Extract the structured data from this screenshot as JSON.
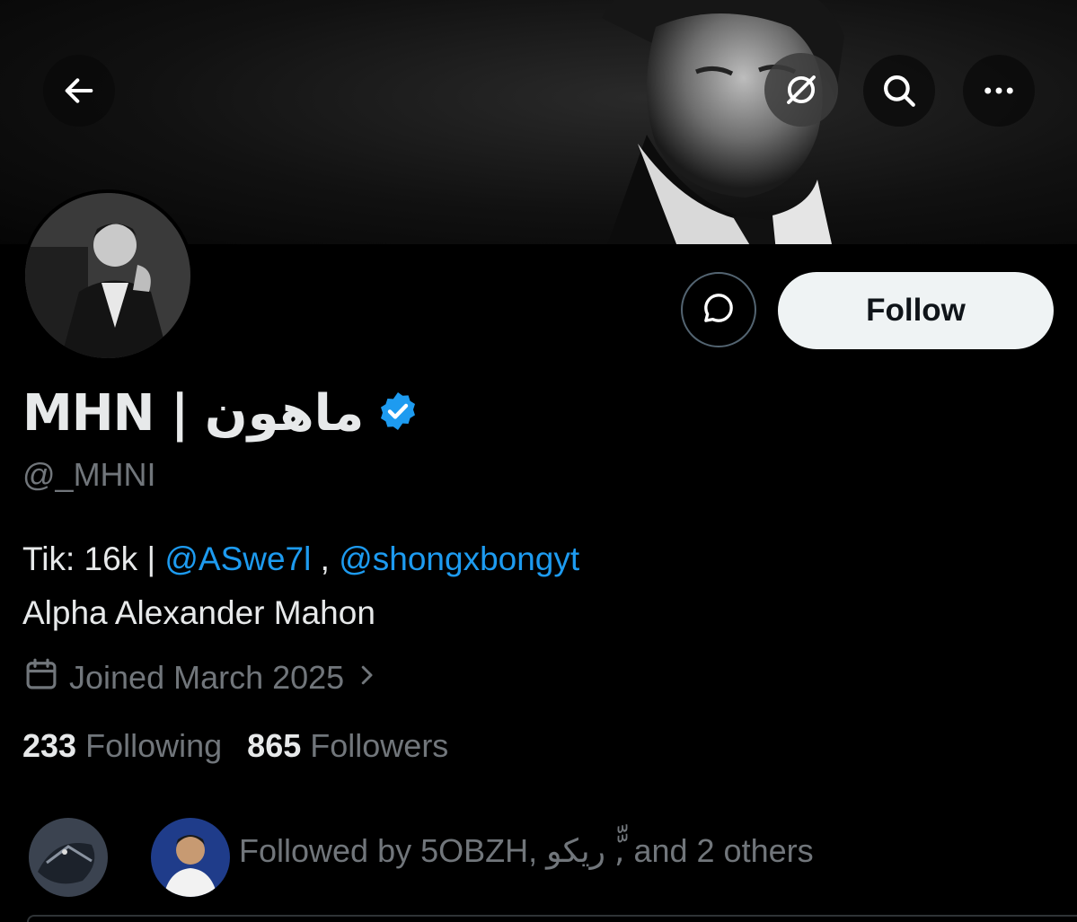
{
  "nav": {
    "back_icon": "arrow-left-icon",
    "grok_icon": "grok-icon",
    "search_icon": "search-icon",
    "more_icon": "ellipsis-icon"
  },
  "profile": {
    "name_latin": "MHN",
    "name_separator": "|",
    "name_arabic": "ماهون",
    "verified_color": "#1d9bf0",
    "handle": "@_MHNI",
    "bio_prefix": "Tik: 16k | ",
    "bio_mention_1": "@ASwe7l",
    "bio_separator": " , ",
    "bio_mention_2": "@shongxbongyt",
    "bio_line_2": "Alpha Alexander Mahon",
    "joined": "Joined March 2025",
    "following_count": "233",
    "following_label": "Following",
    "followers_count": "865",
    "followers_label": "Followers",
    "followed_by": "Followed by 5OBZH, ريكو ,ّّ and 2 others"
  },
  "actions": {
    "message_icon": "message-bubble-icon",
    "follow_label": "Follow"
  },
  "colors": {
    "background": "#000000",
    "text": "#e7e9ea",
    "muted": "#71767b",
    "accent": "#1d9bf0",
    "follow_button": "#eff3f4"
  }
}
